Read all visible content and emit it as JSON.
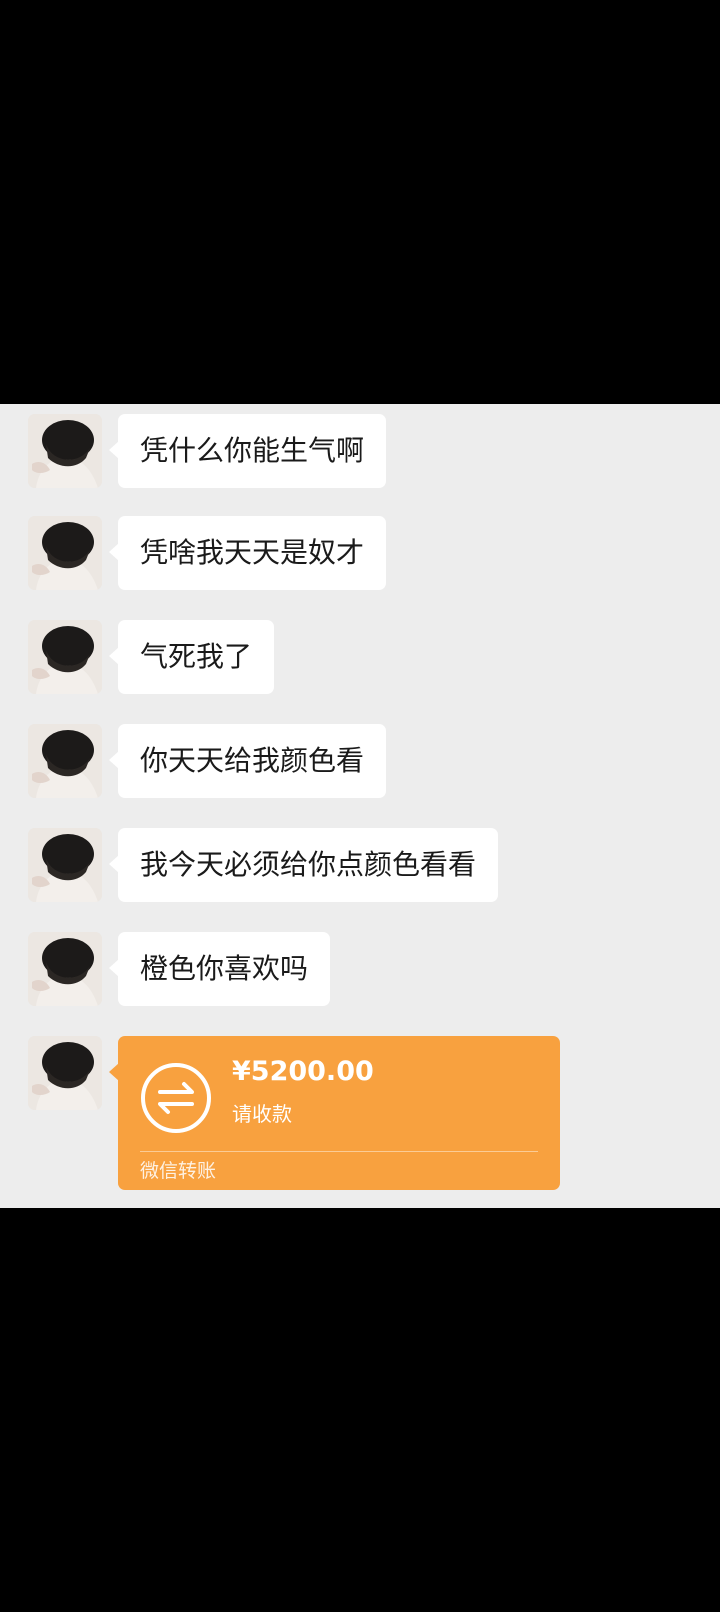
{
  "messages": [
    {
      "sender": "contact",
      "avatar": "avatar-photo",
      "text": "凭什么你能生气啊"
    },
    {
      "sender": "contact",
      "avatar": "avatar-photo",
      "text": "凭啥我天天是奴才"
    },
    {
      "sender": "contact",
      "avatar": "avatar-photo",
      "text": "气死我了"
    },
    {
      "sender": "contact",
      "avatar": "avatar-photo",
      "text": "你天天给我颜色看"
    },
    {
      "sender": "contact",
      "avatar": "avatar-photo",
      "text": "我今天必须给你点颜色看看"
    },
    {
      "sender": "contact",
      "avatar": "avatar-photo",
      "text": "橙色你喜欢吗"
    }
  ],
  "transfer": {
    "amount": "¥5200.00",
    "note": "请收款",
    "footer": "微信转账",
    "icon": "transfer-arrows-icon",
    "color": "#f8a13f"
  },
  "colors": {
    "chat_background": "#ededed",
    "bubble_background": "#ffffff",
    "outer_background": "#000000"
  }
}
